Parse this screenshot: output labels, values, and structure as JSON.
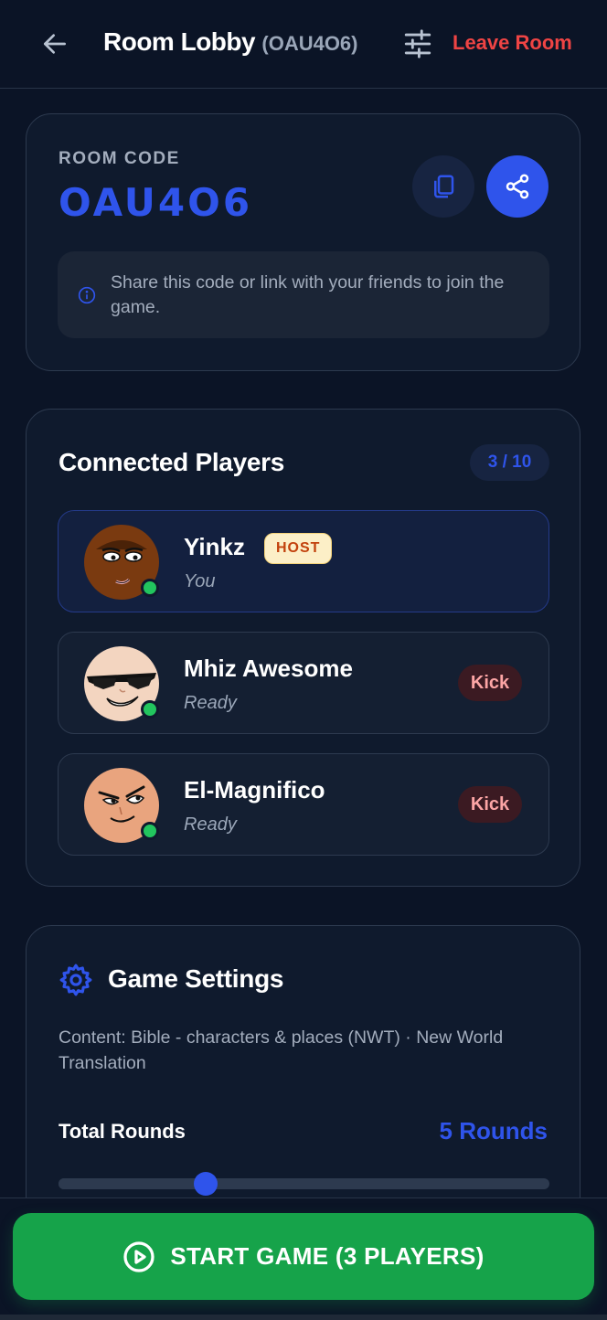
{
  "header": {
    "title": "Room Lobby",
    "room_code_paren": "(OAU4O6)",
    "leave_label": "Leave Room",
    "back_icon": "arrow-left-icon",
    "settings_icon": "sliders-icon"
  },
  "room_card": {
    "label": "ROOM CODE",
    "code": "OAU4O6",
    "copy_icon": "copy-icon",
    "share_icon": "share-icon",
    "info_text": "Share this code or link with your friends to join the game."
  },
  "players_card": {
    "title": "Connected Players",
    "count": "3 / 10",
    "players": [
      {
        "name": "Yinkz",
        "badge": "HOST",
        "status": "You",
        "online": true,
        "is_host": true
      },
      {
        "name": "Mhiz Awesome",
        "status": "Ready",
        "online": true,
        "action": "Kick"
      },
      {
        "name": "El-Magnifico",
        "status": "Ready",
        "online": true,
        "action": "Kick"
      }
    ]
  },
  "settings_card": {
    "title": "Game Settings",
    "content_text": "Content: Bible - characters & places (NWT) · New World Translation",
    "rounds_label": "Total Rounds",
    "rounds_value": "5 Rounds",
    "rounds_slider_fraction": 0.3
  },
  "footer": {
    "start_label": "START GAME (3 PLAYERS)",
    "play_icon": "play-circle-icon"
  },
  "colors": {
    "background": "#0b1426",
    "card": "#0f1a2d",
    "accent": "#2f54eb",
    "danger": "#ef4444",
    "success": "#16a34a",
    "online": "#22c55e"
  }
}
